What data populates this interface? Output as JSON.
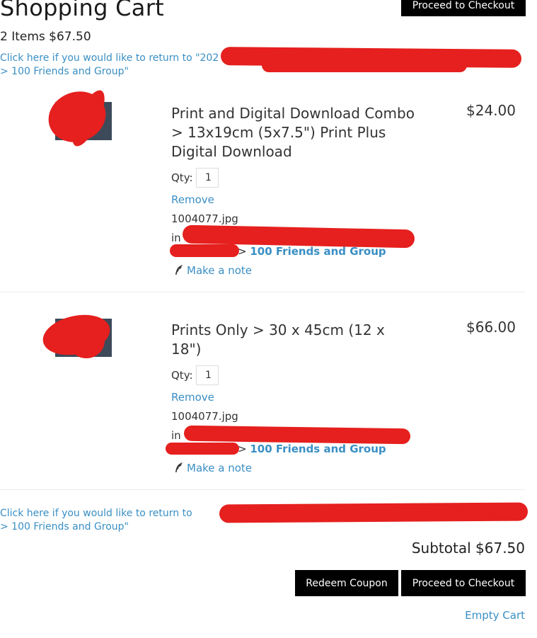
{
  "header": {
    "title": "Shopping Cart",
    "summary": "2 Items $67.50",
    "checkout_top_label": "Proceed to Checkout"
  },
  "return_link": {
    "top_line1": "Click here if you would like to return to \"202",
    "top_line2": "> 100 Friends and Group\"",
    "bottom_line1": "Click here if you would like to return to",
    "bottom_line2": "> 100 Friends and Group\""
  },
  "items": [
    {
      "title": "Print and Digital Download Combo > 13x19cm (5x7.5\") Print Plus Digital Download",
      "price": "$24.00",
      "qty_label": "Qty:",
      "qty_value": "1",
      "remove_label": "Remove",
      "filename": "1004077.jpg",
      "in_label": "in",
      "gallery_sep": ">",
      "gallery_name": "100 Friends and Group",
      "note_label": "Make a note"
    },
    {
      "title": "Prints Only > 30 x 45cm (12 x 18\")",
      "price": "$66.00",
      "qty_label": "Qty:",
      "qty_value": "1",
      "remove_label": "Remove",
      "filename": "1004077.jpg",
      "in_label": "in",
      "gallery_sep": ">",
      "gallery_name": "100 Friends and Group",
      "note_label": "Make a note"
    }
  ],
  "footer": {
    "subtotal": "Subtotal $67.50",
    "redeem_coupon_label": "Redeem Coupon",
    "checkout_label": "Proceed to Checkout",
    "empty_cart_label": "Empty Cart"
  },
  "colors": {
    "link": "#3a8fc4",
    "button_bg": "#000000",
    "redaction": "#e5201e"
  },
  "icons": [
    "feather-icon"
  ]
}
